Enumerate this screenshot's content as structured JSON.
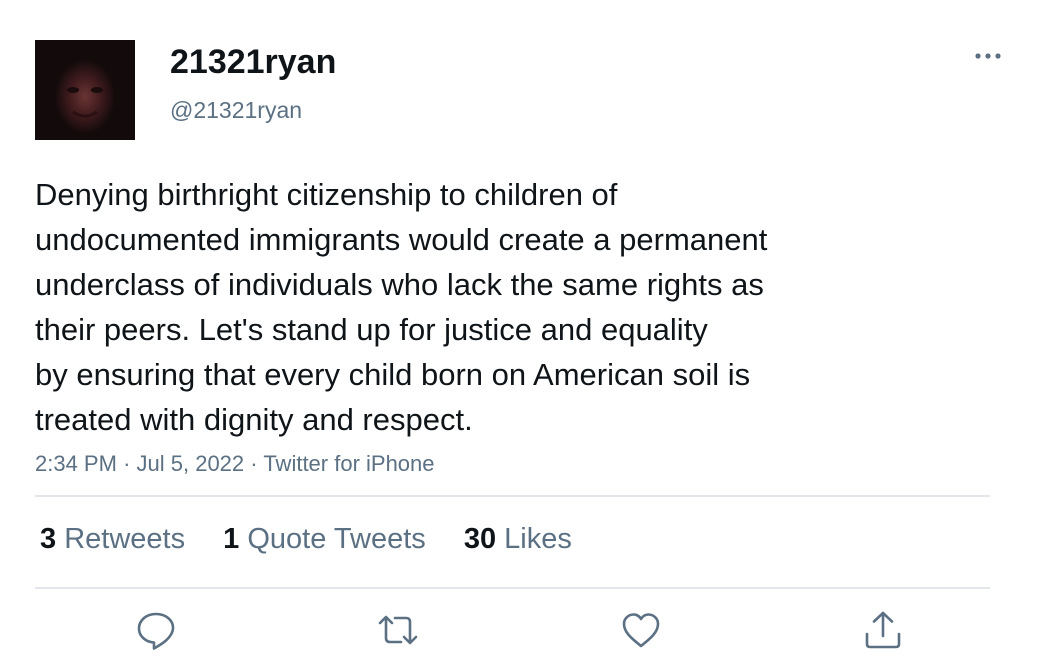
{
  "user": {
    "display_name": "21321ryan",
    "handle": "@21321ryan"
  },
  "tweet": {
    "text": "Denying birthright citizenship to children of\nundocumented immigrants would create a permanent\nunderclass of individuals who lack the same rights as\ntheir peers. Let's stand up for justice and equality\nby ensuring that every child born on American soil is\ntreated with dignity and respect.",
    "time": "2:34 PM",
    "date": "Jul 5, 2022",
    "source": "Twitter for iPhone",
    "separator": "·"
  },
  "stats": {
    "retweets": {
      "count": "3",
      "label": "Retweets"
    },
    "quote_tweets": {
      "count": "1",
      "label": "Quote Tweets"
    },
    "likes": {
      "count": "30",
      "label": "Likes"
    }
  },
  "actions": [
    "reply-icon",
    "retweet-icon",
    "like-icon",
    "share-icon"
  ],
  "colors": {
    "text_primary": "#0f1419",
    "text_secondary": "#5b7083",
    "divider": "#e3e6ea",
    "icon": "#5b7083"
  }
}
